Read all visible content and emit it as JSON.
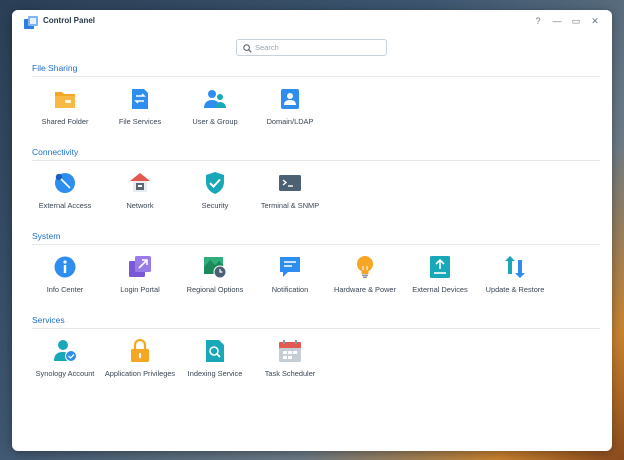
{
  "window": {
    "title": "Control Panel"
  },
  "controls": {
    "help": "?",
    "minimize": "—",
    "maximize": "▭",
    "close": "✕"
  },
  "search": {
    "placeholder": "Search",
    "value": ""
  },
  "sections": [
    {
      "title": "File Sharing",
      "items": [
        {
          "label": "Shared Folder",
          "icon": "shared-folder-icon"
        },
        {
          "label": "File Services",
          "icon": "file-services-icon"
        },
        {
          "label": "User & Group",
          "icon": "user-group-icon"
        },
        {
          "label": "Domain/LDAP",
          "icon": "domain-ldap-icon"
        }
      ]
    },
    {
      "title": "Connectivity",
      "items": [
        {
          "label": "External Access",
          "icon": "external-access-icon"
        },
        {
          "label": "Network",
          "icon": "network-icon"
        },
        {
          "label": "Security",
          "icon": "security-shield-icon"
        },
        {
          "label": "Terminal & SNMP",
          "icon": "terminal-icon"
        }
      ]
    },
    {
      "title": "System",
      "items": [
        {
          "label": "Info Center",
          "icon": "info-center-icon"
        },
        {
          "label": "Login Portal",
          "icon": "login-portal-icon"
        },
        {
          "label": "Regional Options",
          "icon": "regional-options-icon"
        },
        {
          "label": "Notification",
          "icon": "notification-icon"
        },
        {
          "label": "Hardware & Power",
          "icon": "hardware-power-bulb-icon"
        },
        {
          "label": "External Devices",
          "icon": "external-devices-icon"
        },
        {
          "label": "Update & Restore",
          "icon": "update-restore-icon"
        }
      ]
    },
    {
      "title": "Services",
      "items": [
        {
          "label": "Synology Account",
          "icon": "synology-account-icon"
        },
        {
          "label": "Application Privileges",
          "icon": "application-privileges-lock-icon"
        },
        {
          "label": "Indexing Service",
          "icon": "indexing-service-icon"
        },
        {
          "label": "Task Scheduler",
          "icon": "task-scheduler-calendar-icon"
        }
      ]
    }
  ],
  "colors": {
    "accent": "#1e6fc9",
    "orange": "#f5a623",
    "blue": "#2d8ef0",
    "teal": "#19a8b8"
  }
}
